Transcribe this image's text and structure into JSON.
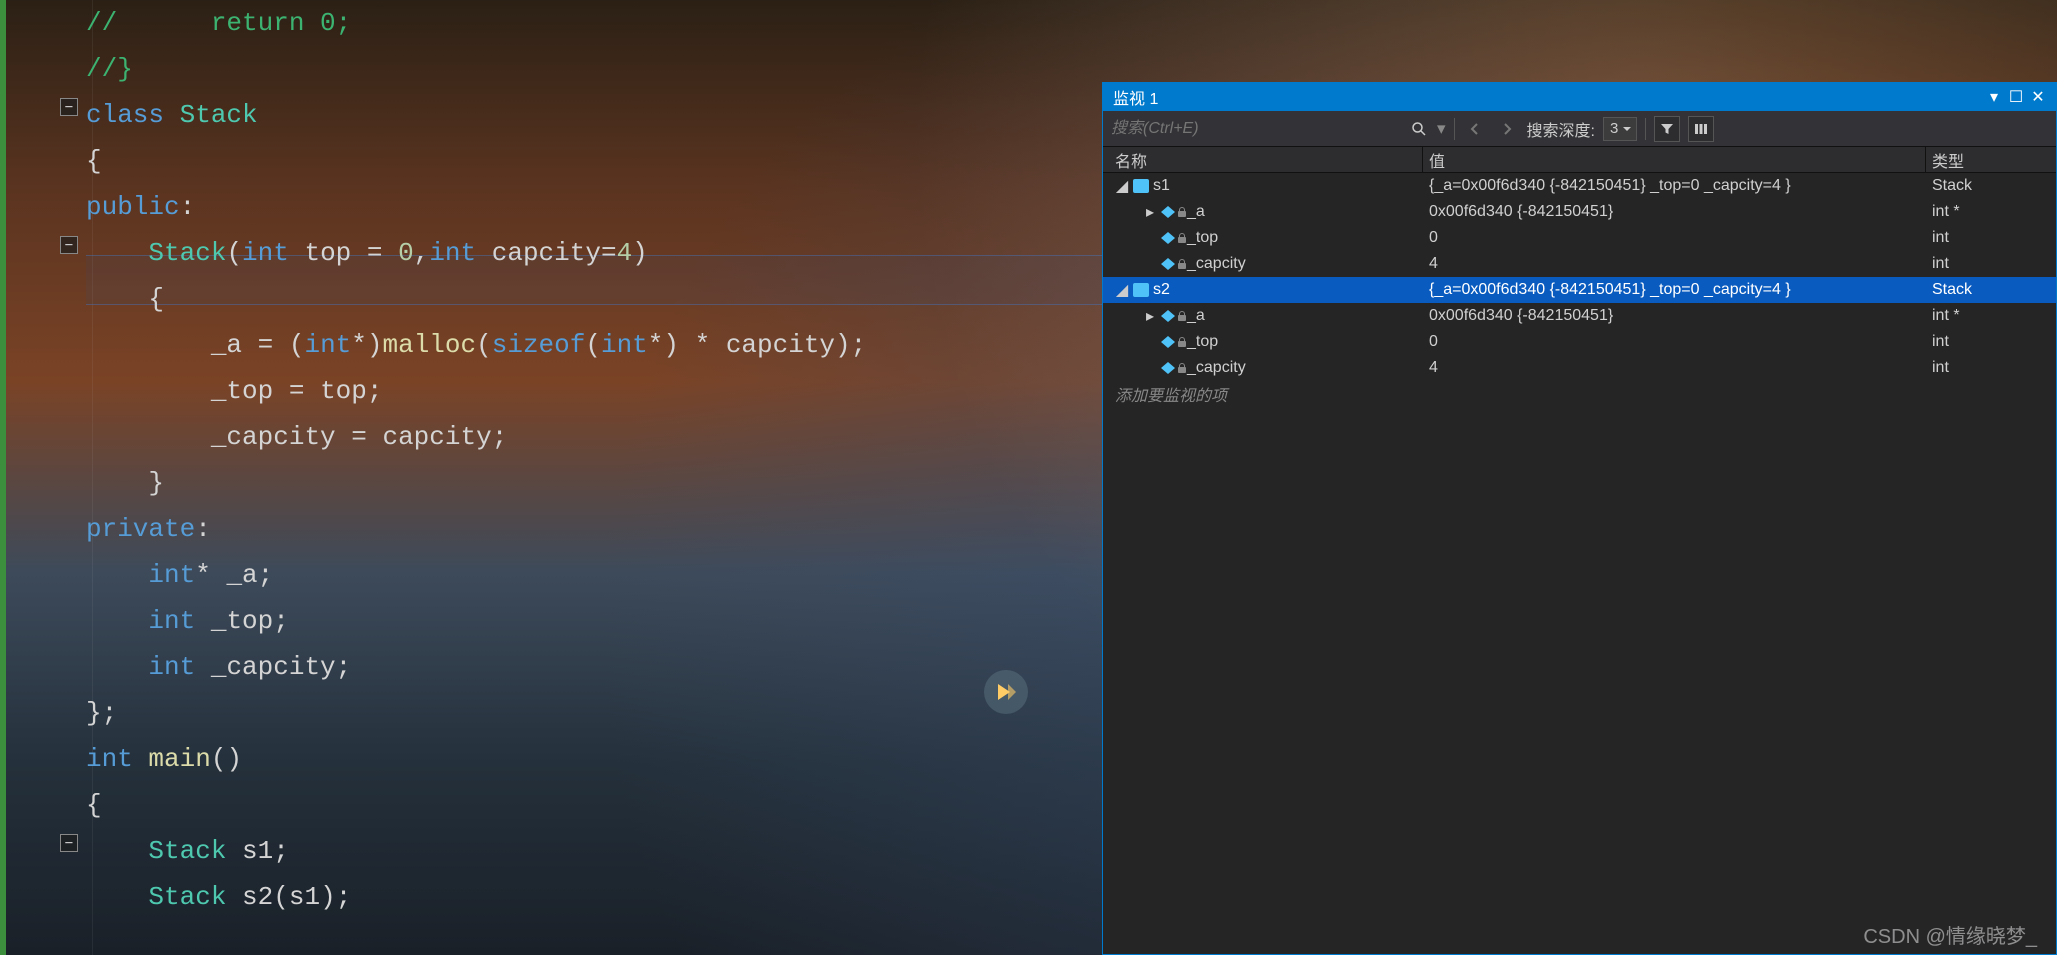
{
  "code_lines": [
    {
      "indent": 0,
      "fold": null,
      "tokens": [
        [
          "comment",
          "//\treturn 0;"
        ]
      ]
    },
    {
      "indent": 0,
      "fold": null,
      "tokens": [
        [
          "comment",
          "//}"
        ]
      ]
    },
    {
      "indent": 0,
      "fold": "minus",
      "tokens": [
        [
          "key",
          "class"
        ],
        [
          "op",
          " "
        ],
        [
          "class",
          "Stack"
        ]
      ]
    },
    {
      "indent": 0,
      "fold": null,
      "tokens": [
        [
          "op",
          "{"
        ]
      ]
    },
    {
      "indent": 0,
      "fold": null,
      "tokens": [
        [
          "key",
          "public"
        ],
        [
          "op",
          ":"
        ]
      ]
    },
    {
      "indent": 1,
      "fold": "minus",
      "tokens": [
        [
          "class",
          "Stack"
        ],
        [
          "paren",
          "("
        ],
        [
          "key",
          "int"
        ],
        [
          "op",
          " "
        ],
        [
          "id",
          "top"
        ],
        [
          "op",
          " = "
        ],
        [
          "num",
          "0"
        ],
        [
          "op",
          ","
        ],
        [
          "key",
          "int"
        ],
        [
          "op",
          " "
        ],
        [
          "id",
          "capcity"
        ],
        [
          "op",
          "="
        ],
        [
          "num",
          "4"
        ],
        [
          "paren",
          ")"
        ]
      ]
    },
    {
      "indent": 1,
      "fold": null,
      "tokens": [
        [
          "op",
          "{"
        ]
      ]
    },
    {
      "indent": 2,
      "fold": null,
      "tokens": [
        [
          "id",
          "_a"
        ],
        [
          "op",
          " = "
        ],
        [
          "paren",
          "("
        ],
        [
          "key",
          "int"
        ],
        [
          "op",
          "*"
        ],
        [
          "paren",
          ")"
        ],
        [
          "func",
          "malloc"
        ],
        [
          "paren",
          "("
        ],
        [
          "key",
          "sizeof"
        ],
        [
          "paren",
          "("
        ],
        [
          "key",
          "int"
        ],
        [
          "op",
          "*"
        ],
        [
          "paren",
          ")"
        ],
        [
          "op",
          " * "
        ],
        [
          "id",
          "capcity"
        ],
        [
          "paren",
          ")"
        ],
        [
          "op",
          ";"
        ]
      ]
    },
    {
      "indent": 2,
      "fold": null,
      "tokens": [
        [
          "id",
          "_top"
        ],
        [
          "op",
          " = "
        ],
        [
          "id",
          "top"
        ],
        [
          "op",
          ";"
        ]
      ]
    },
    {
      "indent": 2,
      "fold": null,
      "tokens": [
        [
          "id",
          "_capcity"
        ],
        [
          "op",
          " = "
        ],
        [
          "id",
          "capcity"
        ],
        [
          "op",
          ";"
        ]
      ]
    },
    {
      "indent": 1,
      "fold": null,
      "tokens": [
        [
          "op",
          "}"
        ]
      ]
    },
    {
      "indent": 0,
      "fold": null,
      "tokens": [
        [
          "op",
          ""
        ]
      ]
    },
    {
      "indent": 0,
      "fold": null,
      "tokens": [
        [
          "key",
          "private"
        ],
        [
          "op",
          ":"
        ]
      ]
    },
    {
      "indent": 1,
      "fold": null,
      "tokens": [
        [
          "key",
          "int"
        ],
        [
          "op",
          "* "
        ],
        [
          "id",
          "_a"
        ],
        [
          "op",
          ";"
        ]
      ]
    },
    {
      "indent": 1,
      "fold": null,
      "tokens": [
        [
          "key",
          "int"
        ],
        [
          "op",
          " "
        ],
        [
          "id",
          "_top"
        ],
        [
          "op",
          ";"
        ]
      ]
    },
    {
      "indent": 1,
      "fold": null,
      "tokens": [
        [
          "key",
          "int"
        ],
        [
          "op",
          " "
        ],
        [
          "id",
          "_capcity"
        ],
        [
          "op",
          ";"
        ]
      ]
    },
    {
      "indent": 0,
      "fold": null,
      "tokens": [
        [
          "op",
          ""
        ]
      ]
    },
    {
      "indent": 0,
      "fold": null,
      "tokens": [
        [
          "op",
          "};"
        ]
      ]
    },
    {
      "indent": 0,
      "fold": "minus",
      "tokens": [
        [
          "key",
          "int"
        ],
        [
          "op",
          " "
        ],
        [
          "func",
          "main"
        ],
        [
          "paren",
          "()"
        ]
      ]
    },
    {
      "indent": 0,
      "fold": null,
      "tokens": [
        [
          "op",
          "{"
        ]
      ]
    },
    {
      "indent": 1,
      "fold": null,
      "tokens": [
        [
          "class",
          "Stack"
        ],
        [
          "op",
          " "
        ],
        [
          "id",
          "s1"
        ],
        [
          "op",
          ";"
        ]
      ]
    },
    {
      "indent": 1,
      "fold": null,
      "tokens": [
        [
          "class",
          "Stack"
        ],
        [
          "op",
          " "
        ],
        [
          "id",
          "s2"
        ],
        [
          "paren",
          "("
        ],
        [
          "id",
          "s1"
        ],
        [
          "paren",
          ")"
        ],
        [
          "op",
          ";"
        ]
      ]
    }
  ],
  "watch": {
    "title": "监视 1",
    "search_placeholder": "搜索(Ctrl+E)",
    "depth_label": "搜索深度:",
    "depth_value": "3",
    "headers": {
      "name": "名称",
      "value": "值",
      "type": "类型"
    },
    "rows": [
      {
        "depth": 0,
        "expander": "down",
        "icon": "obj",
        "name": "s1",
        "value": "{_a=0x00f6d340 {-842150451} _top=0 _capcity=4 }",
        "type": "Stack",
        "selected": false
      },
      {
        "depth": 1,
        "expander": "right",
        "icon": "field",
        "name": "_a",
        "value": "0x00f6d340 {-842150451}",
        "type": "int *",
        "selected": false
      },
      {
        "depth": 1,
        "expander": "",
        "icon": "field",
        "name": "_top",
        "value": "0",
        "type": "int",
        "selected": false
      },
      {
        "depth": 1,
        "expander": "",
        "icon": "field",
        "name": "_capcity",
        "value": "4",
        "type": "int",
        "selected": false
      },
      {
        "depth": 0,
        "expander": "down",
        "icon": "obj",
        "name": "s2",
        "value": "{_a=0x00f6d340 {-842150451} _top=0 _capcity=4 }",
        "type": "Stack",
        "selected": true
      },
      {
        "depth": 1,
        "expander": "right",
        "icon": "field",
        "name": "_a",
        "value": "0x00f6d340 {-842150451}",
        "type": "int *",
        "selected": false
      },
      {
        "depth": 1,
        "expander": "",
        "icon": "field",
        "name": "_top",
        "value": "0",
        "type": "int",
        "selected": false
      },
      {
        "depth": 1,
        "expander": "",
        "icon": "field",
        "name": "_capcity",
        "value": "4",
        "type": "int",
        "selected": false
      }
    ],
    "add_row": "添加要监视的项"
  },
  "watermark": "CSDN @情缘晓梦_"
}
